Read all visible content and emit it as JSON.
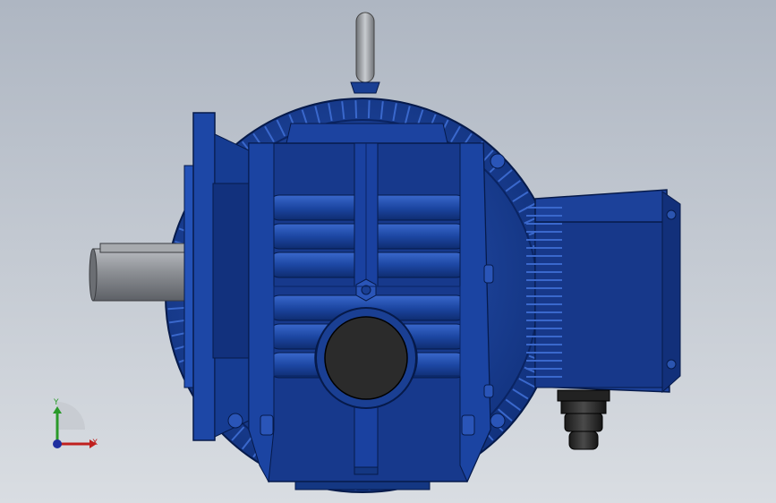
{
  "viewport": {
    "background_top": "#aeb6c2",
    "background_bottom": "#d9dde2"
  },
  "model": {
    "body_color": "#1a3f93",
    "body_dark": "#0d2a6e",
    "body_light": "#3461c4",
    "shaft_color": "#8c8f94",
    "eyebolt_color": "#9a9da2",
    "bore_color": "#2b2b2b"
  },
  "triad": {
    "x_label": "X",
    "y_label": "Y",
    "x_color": "#c0201e",
    "y_color": "#2a9a2a",
    "z_color": "#1f2fa0"
  }
}
